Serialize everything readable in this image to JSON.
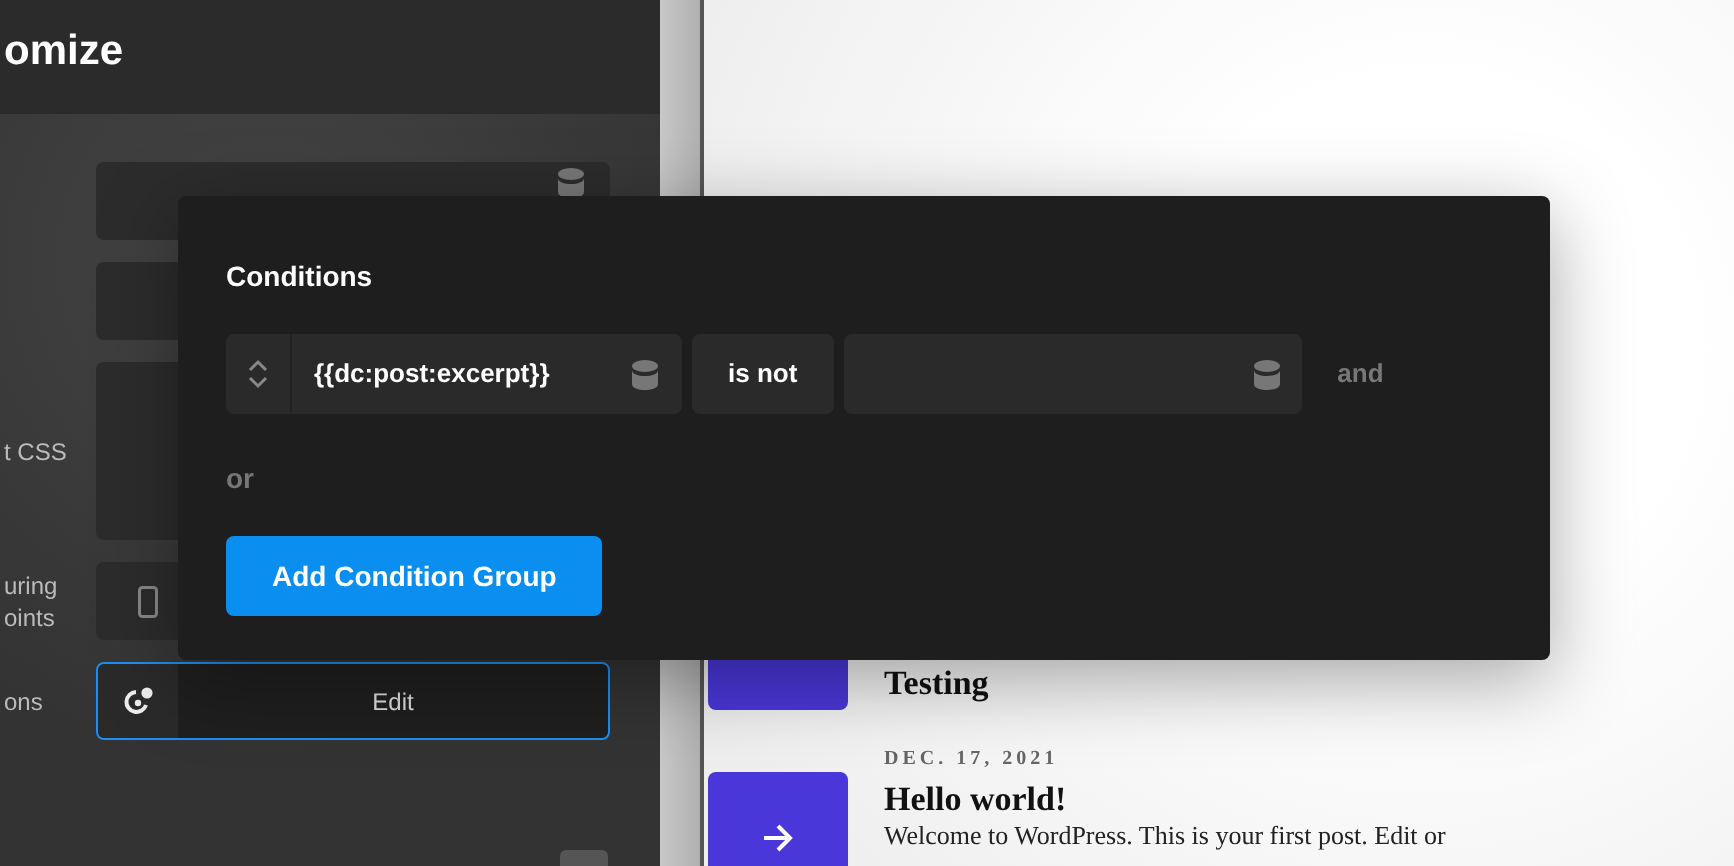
{
  "sidebar": {
    "title": "omize",
    "fields": [
      {
        "kind": "dynamic"
      },
      {
        "kind": "text"
      },
      {
        "kind": "textarea",
        "label_lines": [
          "t CSS"
        ]
      },
      {
        "kind": "breakpoint",
        "label_lines": [
          "uring",
          "oints"
        ]
      },
      {
        "kind": "conditions",
        "label_lines": [
          "ons"
        ],
        "button": "Edit",
        "focused": true
      }
    ]
  },
  "preview": {
    "posts": [
      {
        "title": "Testing"
      },
      {
        "date": "DEC. 17, 2021",
        "title": "Hello world!",
        "excerpt": "Welcome to WordPress. This is your first post. Edit or"
      }
    ]
  },
  "conditions_popup": {
    "title": "Conditions",
    "rules": [
      {
        "field": "{{dc:post:excerpt}}",
        "operator": "is not",
        "joiner": "and"
      }
    ],
    "or": "or",
    "add_button": "Add Condition Group"
  }
}
